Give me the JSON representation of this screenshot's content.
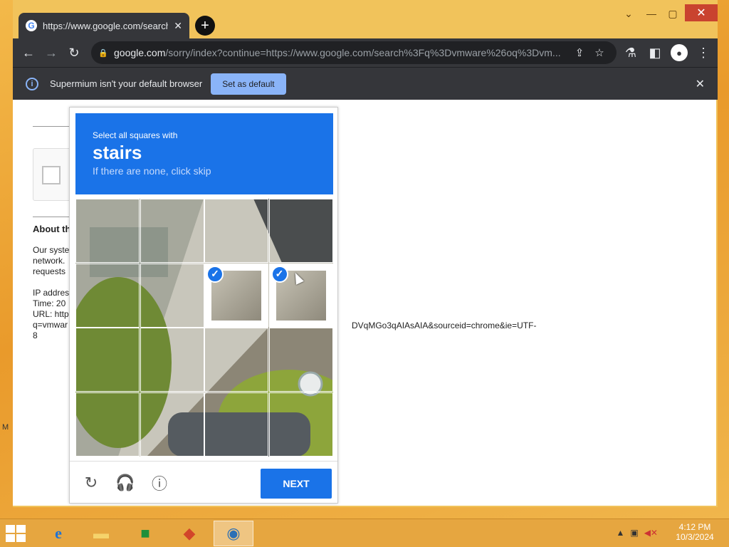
{
  "browser": {
    "tab_title": "https://www.google.com/search",
    "url_host": "google.com",
    "url_path": "/sorry/index?continue=https://www.google.com/search%3Fq%3Dvmware%26oq%3Dvm...",
    "new_tab_symbol": "+",
    "infobar_text": "Supermium isn't your default browser",
    "set_default_label": "Set as default"
  },
  "page": {
    "about_heading": "About th",
    "lines": [
      "Our syste",
      "network.",
      "requests",
      "IP addres",
      "Time: 20",
      "URL: http",
      "q=vmwar",
      "8"
    ],
    "url_tail": "DVqMGo3qAIAsAIA&sourceid=chrome&ie=UTF-"
  },
  "captcha": {
    "pre_text": "Select all squares with",
    "target": "stairs",
    "sub_text": "If there are none, click skip",
    "next_label": "NEXT",
    "tiles": [
      [
        false,
        false,
        false,
        false
      ],
      [
        false,
        false,
        true,
        true
      ],
      [
        false,
        false,
        false,
        false
      ],
      [
        false,
        false,
        false,
        false
      ]
    ],
    "accent_color": "#1a73e8"
  },
  "taskbar": {
    "time": "4:12 PM",
    "date": "10/3/2024"
  },
  "desktop": {
    "edge_letter": "M"
  }
}
